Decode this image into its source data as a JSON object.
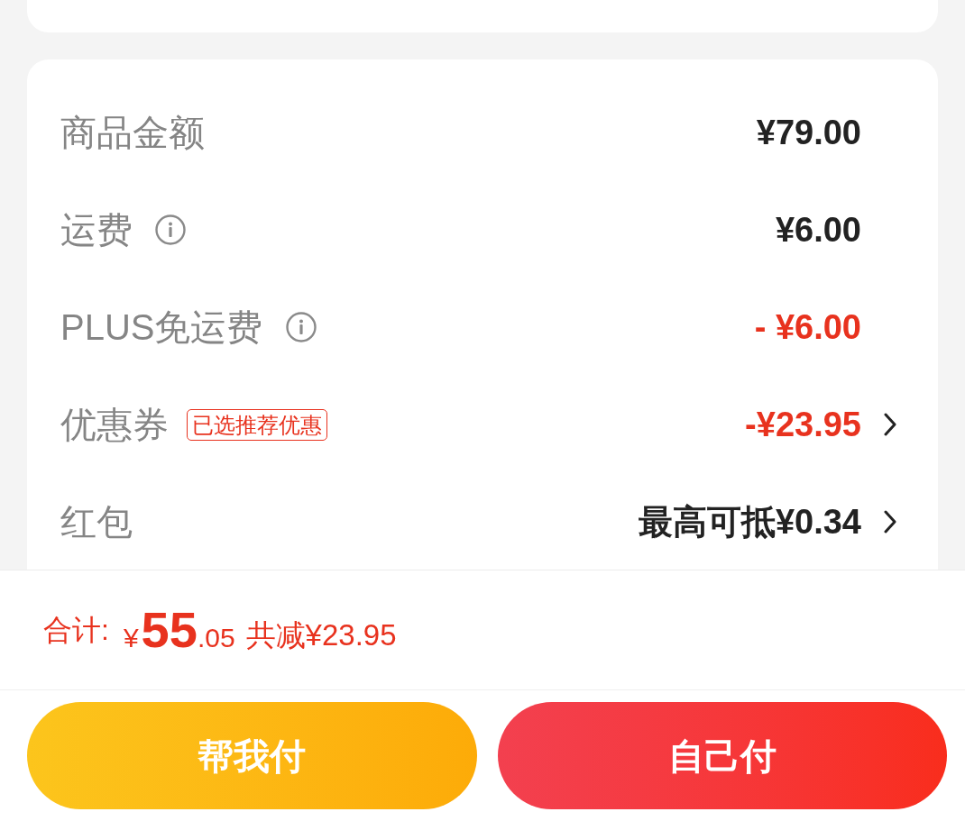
{
  "summary": {
    "rows": [
      {
        "label": "商品金额",
        "info": false,
        "value": "¥79.00",
        "discount": false,
        "chevron": false
      },
      {
        "label": "运费",
        "info": true,
        "value": "¥6.00",
        "discount": false,
        "chevron": false
      },
      {
        "label": "PLUS免运费",
        "info": true,
        "value": "- ¥6.00",
        "discount": true,
        "chevron": false
      },
      {
        "label": "优惠券",
        "info": false,
        "tag": "已选推荐优惠",
        "value": "-¥23.95",
        "discount": true,
        "chevron": true
      },
      {
        "label": "红包",
        "info": false,
        "value": "最高可抵¥0.34",
        "discount": false,
        "chevron": true
      }
    ]
  },
  "total": {
    "label": "合计:",
    "currency": "¥",
    "integer": "55",
    "decimal": ".05",
    "saving": "共减¥23.95"
  },
  "buttons": [
    {
      "label": "帮我付",
      "kind": "secondary"
    },
    {
      "label": "自己付",
      "kind": "primary"
    }
  ]
}
